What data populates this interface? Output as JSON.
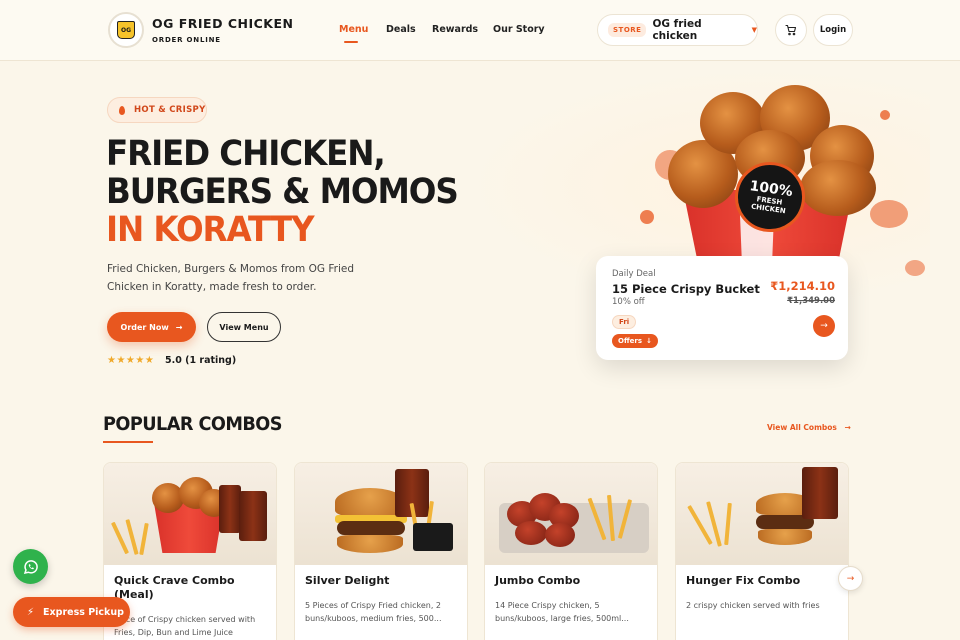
{
  "brand": {
    "name": "OG FRIED CHICKEN",
    "subtitle": "ORDER ONLINE",
    "logo_text": "OG"
  },
  "nav": {
    "items": [
      "Menu",
      "Deals",
      "Rewards",
      "Our Story"
    ],
    "active": "Menu"
  },
  "store": {
    "tag": "STORE",
    "name": "OG fried chicken"
  },
  "header": {
    "login": "Login"
  },
  "hero": {
    "pill": "HOT & CRISPY",
    "line1": "FRIED CHICKEN,",
    "line2": "BURGERS & MOMOS",
    "line3": "IN KORATTY",
    "description": "Fried Chicken, Burgers & Momos from OG Fried Chicken in Koratty, made fresh to order.",
    "order_btn": "Order Now",
    "menu_btn": "View Menu",
    "rating_stars": 5,
    "rating_text": "5.0 (1 rating)",
    "badge_big": "100%",
    "badge_small": "FRESH CHICKEN"
  },
  "deal": {
    "label": "Daily Deal",
    "name": "15 Piece Crispy Bucket",
    "discount": "10% off",
    "price": "₹1,214.10",
    "old_price": "₹1,349.00",
    "day": "Fri",
    "offers": "Offers"
  },
  "combos": {
    "title": "POPULAR COMBOS",
    "view_all": "View All Combos",
    "items": [
      {
        "title": "Quick Crave Combo (Meal)",
        "desc": "Piece of Crispy chicken served with Fries, Dip, Bun and Lime Juice"
      },
      {
        "title": "Silver Delight",
        "desc": "5 Pieces of Crispy Fried chicken, 2 buns/kuboos, medium fries, 500..."
      },
      {
        "title": "Jumbo Combo",
        "desc": "14 Piece Crispy chicken, 5 buns/kuboos, large fries, 500ml..."
      },
      {
        "title": "Hunger Fix Combo",
        "desc": "2 crispy chicken served with fries"
      }
    ]
  },
  "floating": {
    "express": "Express Pickup"
  },
  "colors": {
    "accent": "#e8571f",
    "background": "#fbf6ea",
    "whatsapp": "#2fb24c"
  }
}
